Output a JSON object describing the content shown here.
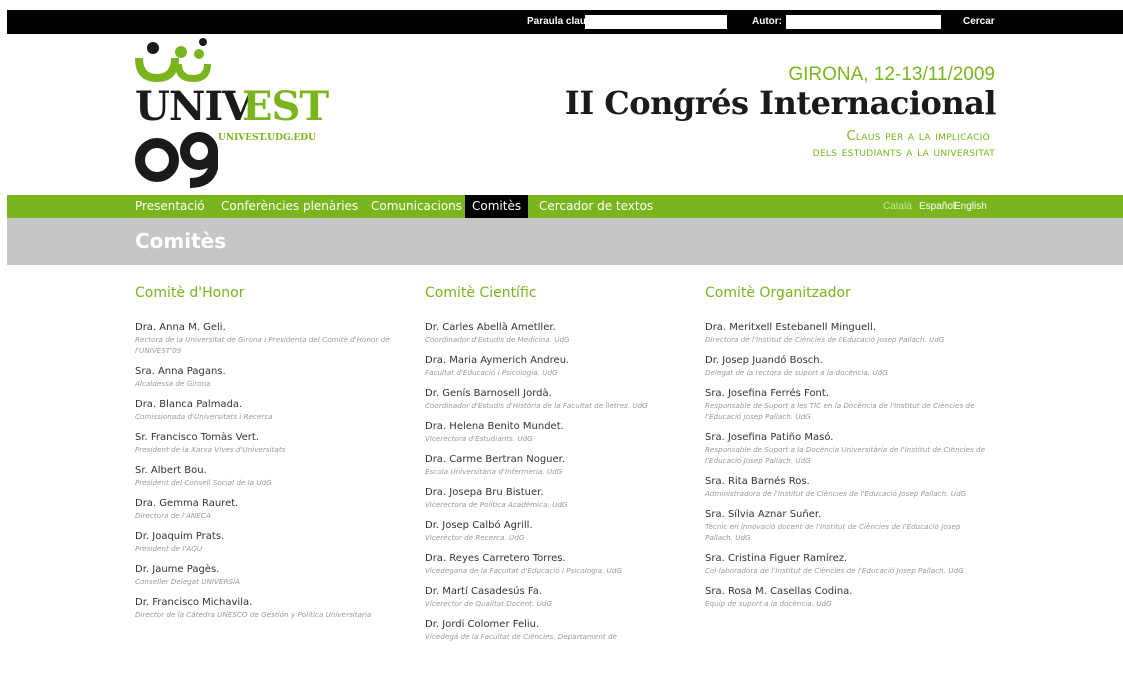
{
  "search": {
    "keyword_label": "Paraula clau:",
    "author_label": "Autor:",
    "button_label": "Cercar",
    "keyword_value": "",
    "author_value": ""
  },
  "logo": {
    "line1": "UNIVEST",
    "line2": "09",
    "url": "UNIVEST.UDG.EDU"
  },
  "header": {
    "date": "GIRONA, 12-13/11/2009",
    "title": "II Congrés Internacional",
    "subtitle_line1": "Claus per a la implicació",
    "subtitle_line2": "dels estudiants a la universitat"
  },
  "nav": {
    "items": [
      {
        "label": "Presentació"
      },
      {
        "label": "Conferències plenàries"
      },
      {
        "label": "Comunicacions"
      },
      {
        "label": "Comitès",
        "active": true
      },
      {
        "label": "Cercador de textos"
      }
    ],
    "languages": [
      {
        "label": "Català",
        "current": true
      },
      {
        "label": "Español"
      },
      {
        "label": "English"
      }
    ]
  },
  "page": {
    "title": "Comitès"
  },
  "committees": [
    {
      "title": "Comitè d'Honor",
      "members": [
        {
          "name": "Dra. Anna M. Geli.",
          "role": "Rectora de la Universitat de Girona i Presidenta del Comitè d'Honor de l'UNIVEST'09"
        },
        {
          "name": "Sra. Anna Pagans.",
          "role": "Alcaldessa de Girona"
        },
        {
          "name": "Dra. Blanca Palmada.",
          "role": "Comissionada d'Universitats i Recerca"
        },
        {
          "name": "Sr. Francisco Tomàs Vert.",
          "role": "President de la Xarxa Vives d'Universitats"
        },
        {
          "name": "Sr. Albert Bou.",
          "role": "President del Consell Social de la UdG"
        },
        {
          "name": "Dra. Gemma Rauret.",
          "role": "Directora de l'ANECA"
        },
        {
          "name": "Dr. Joaquim Prats.",
          "role": "President de l'AQU"
        },
        {
          "name": "Dr. Jaume Pagès.",
          "role": "Conseller Delegat UNIVERSIA"
        },
        {
          "name": "Dr. Francisco Michavila.",
          "role": "Director de la Cátedra UNESCO de Gestión y Política Universitaria"
        }
      ]
    },
    {
      "title": "Comitè Científic",
      "members": [
        {
          "name": "Dr. Carles Abellà Ametller.",
          "role": "Coordinador d'Estudis de Medicina. UdG"
        },
        {
          "name": "Dra. Maria Aymerich Andreu.",
          "role": "Facultat d'Educació i Psicologia. UdG"
        },
        {
          "name": "Dr. Genís Barnosell Jordà.",
          "role": "Coordinador d'Estudis d'Història de la Facultat de lletres. UdG"
        },
        {
          "name": "Dra. Helena Benito Mundet.",
          "role": "Vicerectora d'Estudiants. UdG"
        },
        {
          "name": "Dra. Carme Bertran Noguer.",
          "role": "Escola Universitària d'Infermeria. UdG"
        },
        {
          "name": "Dra. Josepa Bru Bistuer.",
          "role": "Vicerectora de Política Acadèmica. UdG"
        },
        {
          "name": "Dr. Josep Calbó Agrill.",
          "role": "Vicerector de Recerca. UdG"
        },
        {
          "name": "Dra. Reyes Carretero Torres.",
          "role": "Vicedegana de la Facultat d'Educació i Psicologia. UdG"
        },
        {
          "name": "Dr. Martí Casadesús Fa.",
          "role": "Vicerector de Qualitat Docent. UdG"
        },
        {
          "name": "Dr. Jordi Colomer Feliu.",
          "role": "Vicedegà de la Facultat de Ciències. Departament de"
        }
      ]
    },
    {
      "title": "Comitè Organitzador",
      "members": [
        {
          "name": "Dra. Meritxell Estebanell Minguell.",
          "role": "Directora de l'Institut de Ciències de l'Educació Josep Pallach. UdG"
        },
        {
          "name": "Dr. Josep Juandó Bosch.",
          "role": "Delegat de la rectora de suport a la docència. UdG"
        },
        {
          "name": "Sra. Josefina Ferrés Font.",
          "role": "Responsable de Suport a les TIC en la Docència de l'Institut de Ciències de l'Educació Josep Pallach. UdG"
        },
        {
          "name": "Sra. Josefina Patiño Masó.",
          "role": "Responsable de Suport a la Docència Universitària de l'Institut de Ciències de l'Educació Josep Pallach. UdG"
        },
        {
          "name": "Sra. Rita Barnés Ros.",
          "role": "Administradora de l'Institut de Ciències de l'Educació Josep Pallach. UdG"
        },
        {
          "name": "Sra. Sílvia Aznar Suñer.",
          "role": "Tècnic en innovació docent de l'Institut de Ciències de l'Educació Josep Pallach. UdG"
        },
        {
          "name": "Sra. Cristina Figuer Ramírez.",
          "role": "Col·laboradora de l'Institut de Ciències de l'Educació Josep Pallach. UdG"
        },
        {
          "name": "Sra. Rosa M. Casellas Codina.",
          "role": "Equip de suport a la docència. UdG"
        }
      ]
    }
  ]
}
